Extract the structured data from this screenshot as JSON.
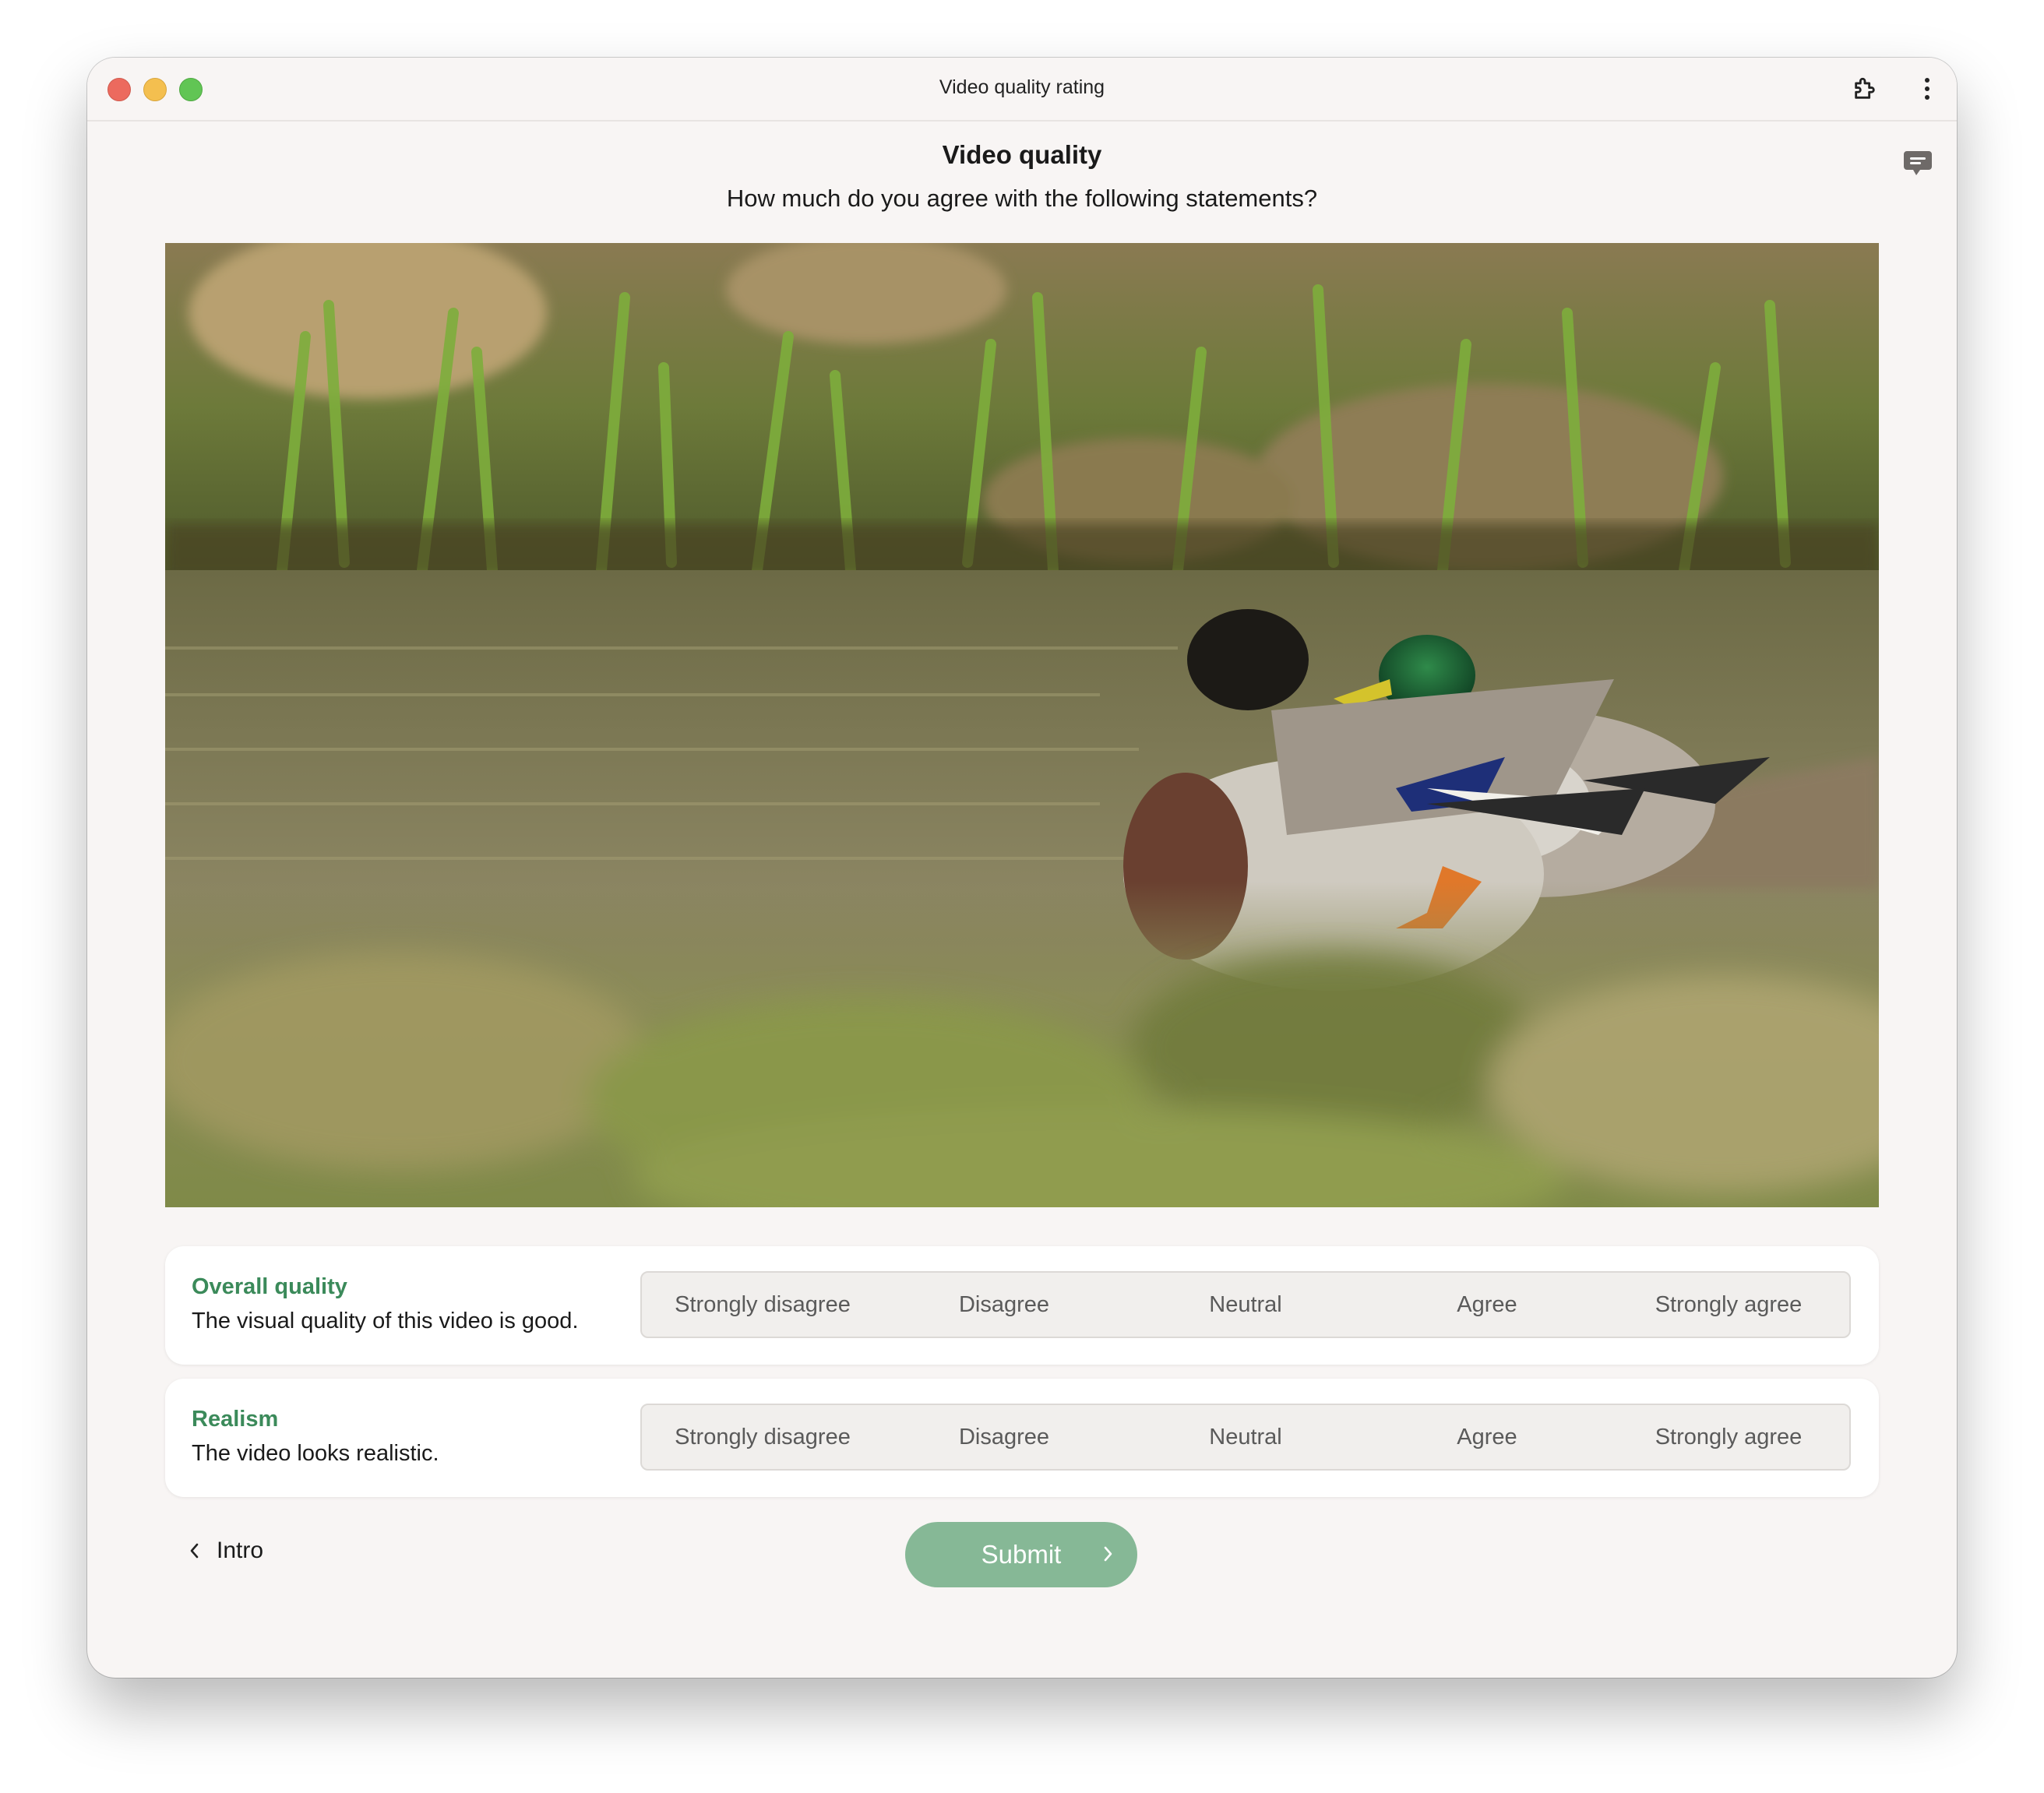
{
  "window": {
    "title": "Video quality rating"
  },
  "survey": {
    "heading": "Video quality",
    "instruction": "How much do you agree with the following statements?"
  },
  "video": {
    "description_icon": "video-frame"
  },
  "questions": [
    {
      "title": "Overall quality",
      "statement": "The visual quality of this video is good.",
      "options": [
        "Strongly disagree",
        "Disagree",
        "Neutral",
        "Agree",
        "Strongly agree"
      ]
    },
    {
      "title": "Realism",
      "statement": "The video looks realistic.",
      "options": [
        "Strongly disagree",
        "Disagree",
        "Neutral",
        "Agree",
        "Strongly agree"
      ]
    }
  ],
  "navigation": {
    "back_label": "Intro",
    "submit_label": "Submit"
  },
  "colors": {
    "accent": "#3b8a5a",
    "submit_bg": "#86b896",
    "window_bg": "#f8f5f4"
  }
}
